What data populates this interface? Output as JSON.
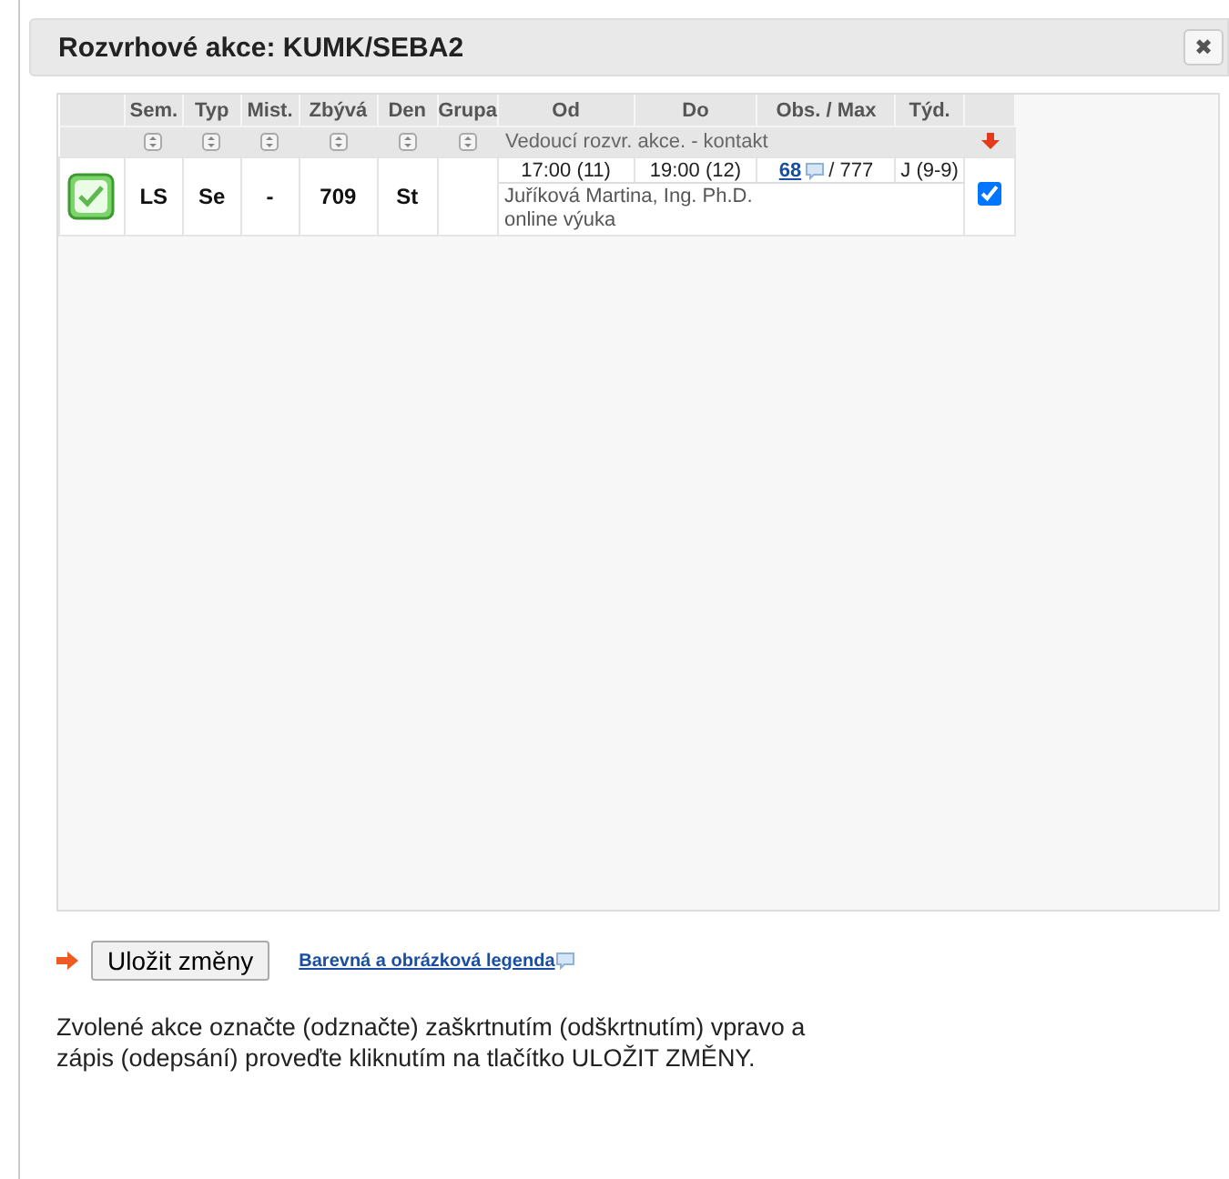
{
  "dialog": {
    "title": "Rozvrhové akce: KUMK/SEBA2",
    "close": "✖"
  },
  "table": {
    "columns": [
      "Sem.",
      "Typ",
      "Mist.",
      "Zbývá",
      "Den",
      "Grupa",
      "Od",
      "Do",
      "Obs. / Max",
      "Týd."
    ],
    "filter_text": "Vedoucí rozvr. akce. - kontakt",
    "rows": [
      {
        "selected": true,
        "sem": "LS",
        "typ": "Se",
        "mist": "-",
        "zbyva": "709",
        "den": "St",
        "od": "17:00 (11)",
        "do": "19:00 (12)",
        "obs": "68",
        "max": "/ 777",
        "tyd": "J (9-9)",
        "teacher": "Juříková Martina, Ing. Ph.D.",
        "note": "online výuka",
        "checked": true
      }
    ]
  },
  "save_button": "Uložit změny",
  "legend_link": "Barevná a obrázková legenda",
  "instruction": "Zvolené akce označte (odznačte) zaškrtnutím (odškrtnutím) vpravo a zápis (odepsání) proveďte kliknutím na tlačítko ULOŽIT ZMĚNY."
}
